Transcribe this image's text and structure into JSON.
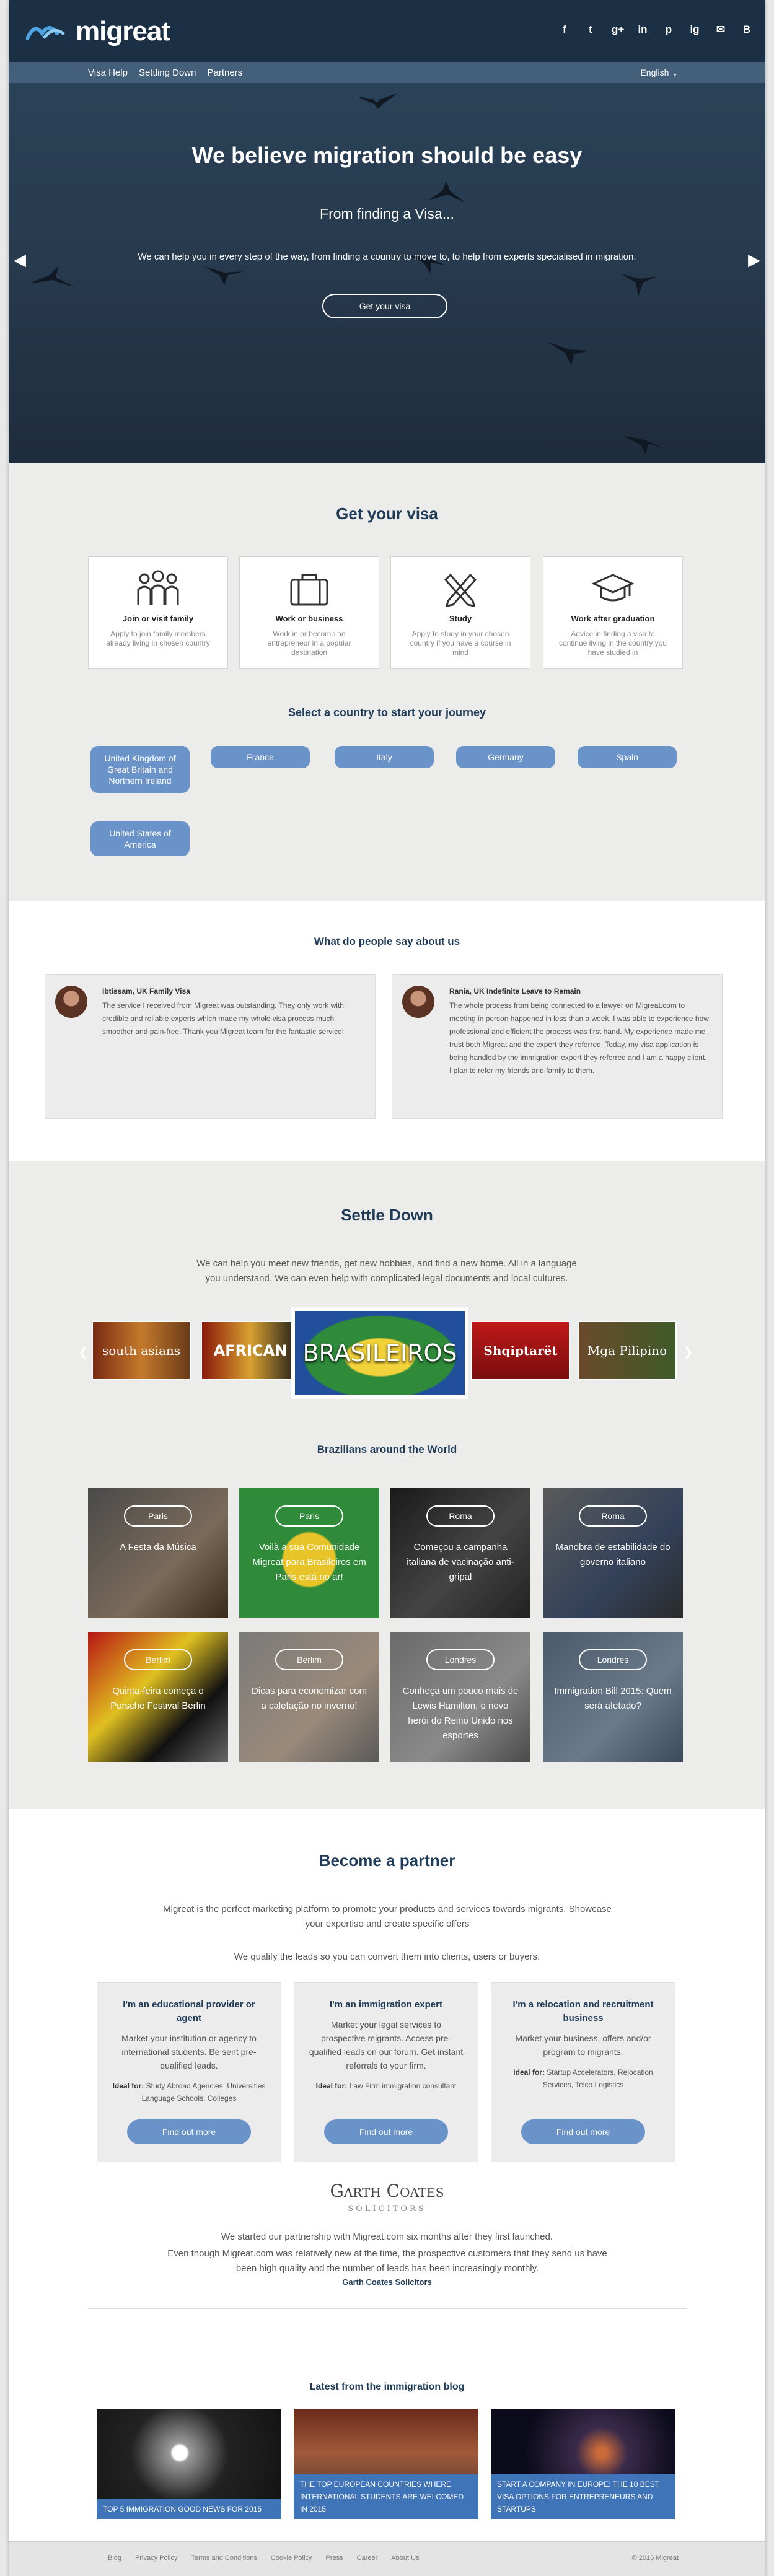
{
  "header": {
    "brand": "migreat",
    "social_icons": [
      "f",
      "t",
      "g+",
      "in",
      "p",
      "ig",
      "✉",
      "B"
    ],
    "nav": [
      "Visa Help",
      "Settling Down",
      "Partners"
    ],
    "language": "English ⌄"
  },
  "hero": {
    "title": "We believe migration should be easy",
    "subtitle": "From finding a Visa...",
    "text": "We can help you in every step of the way, from finding a country to move to, to help from experts specialised in migration.",
    "button": "Get your visa"
  },
  "visa": {
    "title": "Get your visa",
    "cards": [
      {
        "title": "Join or visit family",
        "text": "Apply to join family members already living in chosen country",
        "icon": "family-icon"
      },
      {
        "title": "Work or business",
        "text": "Work in or become an entrepreneur in a popular destination",
        "icon": "briefcase-icon"
      },
      {
        "title": "Study",
        "text": "Apply to study in your chosen country if you have a course in mind",
        "icon": "pencils-icon"
      },
      {
        "title": "Work after graduation",
        "text": "Advice in finding a visa to continue living in the country you have studied in",
        "icon": "graduation-cap-icon"
      }
    ],
    "country_title": "Select a country to start your journey",
    "countries": [
      "United Kingdom of Great Britain and Northern Ireland",
      "France",
      "Italy",
      "Germany",
      "Spain",
      "United States of America"
    ]
  },
  "testimonials": {
    "title": "What do people say about us",
    "items": [
      {
        "name": "Ibtissam, UK Family Visa",
        "text": "The service I received from Migreat was outstanding. They only work with credible and reliable experts which made my whole visa process much smoother and pain-free. Thank you Migreat team for the fantastic service!"
      },
      {
        "name": "Rania, UK Indefinite Leave to Remain",
        "text": "The whole process from being connected to a lawyer on Migreat.com to meeting in person happened in less than a week. I was able to experience how professional and efficient the process was first hand. My experience made me trust both Migreat and the expert they referred. Today, my visa application is being handled by the immigration expert they referred and I am a happy client. I plan to refer my friends and family to them."
      }
    ]
  },
  "settle": {
    "title": "Settle Down",
    "intro": "We can help you meet new friends, get new hobbies, and find a new home. All in a language you understand. We can even help with complicated legal documents and local cultures.",
    "communities": [
      "south asians",
      "AFRICAN",
      "BRASILEIROS",
      "Shqiptarët",
      "Mga Pilipino"
    ],
    "grid_title": "Brazilians around the World",
    "tiles": [
      {
        "city": "Paris",
        "caption": "A Festa da Música"
      },
      {
        "city": "Paris",
        "caption": "Voilà a sua Comunidade Migreat para Brasileiros em Paris está no ar!"
      },
      {
        "city": "Roma",
        "caption": "Começou a campanha italiana de vacinação anti-gripal"
      },
      {
        "city": "Roma",
        "caption": "Manobra de estabilidade do governo italiano"
      },
      {
        "city": "Berlim",
        "caption": "Quinta-feira começa o Porsche Festival Berlin"
      },
      {
        "city": "Berlim",
        "caption": "Dicas para economizar com a calefação no inverno!"
      },
      {
        "city": "Londres",
        "caption": "Conheça um pouco mais de Lewis Hamilton, o novo herói do Reino Unido nos esportes"
      },
      {
        "city": "Londres",
        "caption": "Immigration Bill 2015: Quem será afetado?"
      }
    ]
  },
  "partner": {
    "title": "Become a partner",
    "intro": "Migreat is the perfect marketing platform to promote your products and services towards migrants. Showcase your expertise and create specific offers",
    "intro2": "We qualify the leads so you can convert them into clients, users or buyers.",
    "ideal_label": "Ideal for:",
    "cards": [
      {
        "title": "I'm an educational provider or agent",
        "text": "Market your institution or agency to international students. Be sent pre-qualified leads.",
        "ideal": "Study Abroad Agencies, Universities Language Schools, Colleges",
        "button": "Find out more"
      },
      {
        "title": "I'm an immigration expert",
        "text": "Market your legal services to prospective migrants. Access pre-qualified leads on our forum. Get instant referrals to your firm.",
        "ideal": "Law Firm immigration consultant",
        "button": "Find out more"
      },
      {
        "title": "I'm a relocation and recruitment business",
        "text": "Market your business, offers and/or program to migrants.",
        "ideal": "Startup Accelerators, Relocation Services, Telco Logistics",
        "button": "Find out more"
      }
    ],
    "logo_line1": "Garth Coates",
    "logo_line2": "SOLICITORS",
    "quote1": "We started our partnership with Migreat.com six months after they first launched.",
    "quote2": "Even though Migreat.com was relatively new at the time, the prospective customers that they send us have been high quality and the number of leads has been increasingly monthly.",
    "quote_author": "Garth Coates Solicitors"
  },
  "blog": {
    "title": "Latest from the immigration blog",
    "posts": [
      "TOP 5 IMMIGRATION GOOD NEWS FOR 2015",
      "THE TOP EUROPEAN COUNTRIES WHERE INTERNATIONAL STUDENTS ARE WELCOMED IN 2015",
      "START A COMPANY IN EUROPE: THE 10 BEST VISA OPTIONS FOR ENTREPRENEURS AND STARTUPS"
    ]
  },
  "footer": {
    "links": [
      "Blog",
      "Privacy Policy",
      "Terms and Conditions",
      "Cookie Policy",
      "Press",
      "Career",
      "About Us"
    ],
    "copyright": "© 2015 Migreat"
  },
  "colors": {
    "navy": "#1b2f45",
    "nav_blue": "#445f7a",
    "accent": "#6a93c9",
    "blog_blue": "#3f74b8"
  }
}
